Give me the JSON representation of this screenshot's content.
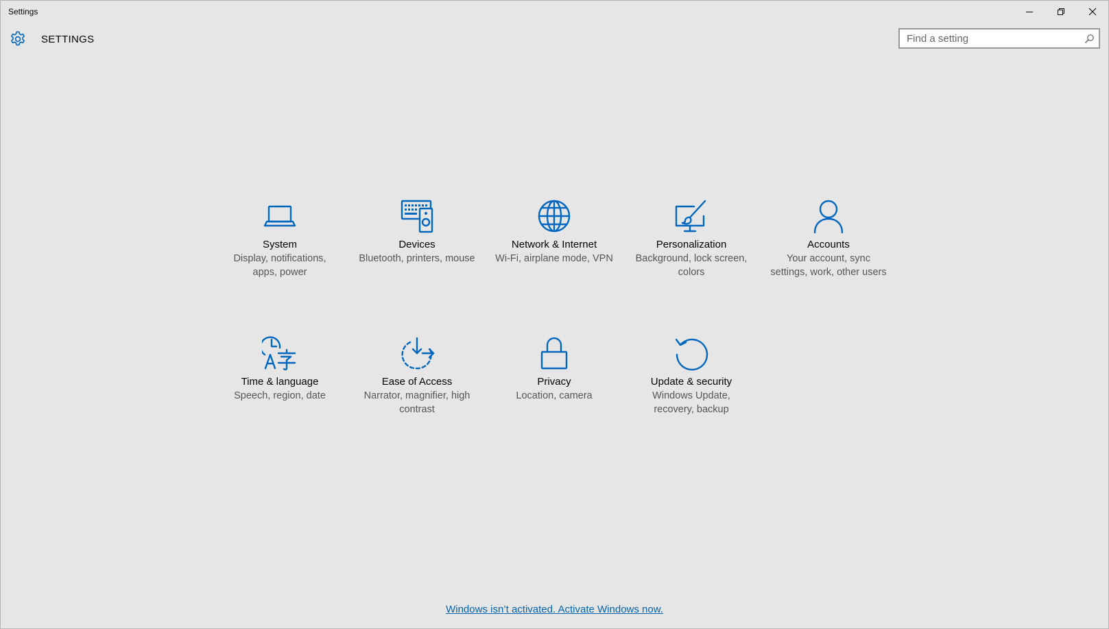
{
  "window": {
    "title": "Settings"
  },
  "header": {
    "title": "SETTINGS",
    "search_placeholder": "Find a setting"
  },
  "tiles": [
    {
      "title": "System",
      "description": "Display, notifications, apps, power",
      "icon": "laptop-icon"
    },
    {
      "title": "Devices",
      "description": "Bluetooth, printers, mouse",
      "icon": "devices-icon"
    },
    {
      "title": "Network & Internet",
      "description": "Wi-Fi, airplane mode, VPN",
      "icon": "globe-icon"
    },
    {
      "title": "Personalization",
      "description": "Background, lock screen, colors",
      "icon": "personalization-icon"
    },
    {
      "title": "Accounts",
      "description": "Your account, sync settings, work, other users",
      "icon": "person-icon"
    },
    {
      "title": "Time & language",
      "description": "Speech, region, date",
      "icon": "time-language-icon"
    },
    {
      "title": "Ease of Access",
      "description": "Narrator, magnifier, high contrast",
      "icon": "ease-of-access-icon"
    },
    {
      "title": "Privacy",
      "description": "Location, camera",
      "icon": "lock-icon"
    },
    {
      "title": "Update & security",
      "description": "Windows Update, recovery, backup",
      "icon": "update-icon"
    }
  ],
  "footer": {
    "activation_text": "Windows isn’t activated. Activate Windows now."
  },
  "colors": {
    "accent": "#0067c0",
    "link": "#0063b1",
    "background": "#e6e6e6"
  }
}
